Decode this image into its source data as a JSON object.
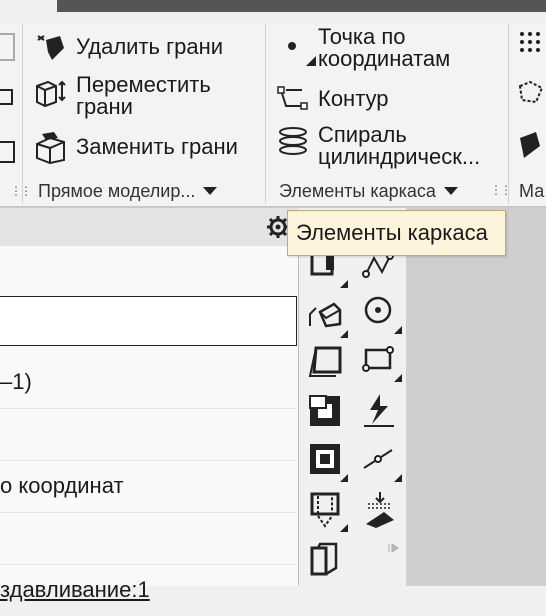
{
  "ribbon": {
    "panel_edit": {
      "delete_faces": "Удалить грани",
      "move_faces": "Переместить\nграни",
      "replace_faces": "Заменить грани",
      "title": "Прямое моделир..."
    },
    "panel_frame": {
      "point_by_coords": "Точка по\nкоординатам",
      "contour": "Контур",
      "spiral": "Спираль\nцилиндрическ...",
      "title": "Элементы каркаса"
    },
    "panel_next": {
      "title": "Ма"
    }
  },
  "tooltip": "Элементы каркаса",
  "tree": {
    "rows": [
      {
        "text": ""
      },
      {
        "text": "–1)"
      },
      {
        "text": ""
      },
      {
        "text": "о координат"
      },
      {
        "text": ""
      },
      {
        "text": "здавливание:1"
      }
    ]
  },
  "colors": {
    "tooltip_bg": "#fdf4dc",
    "ribbon_bg": "#f3f3f3",
    "dark_area": "#cfcfcf"
  }
}
